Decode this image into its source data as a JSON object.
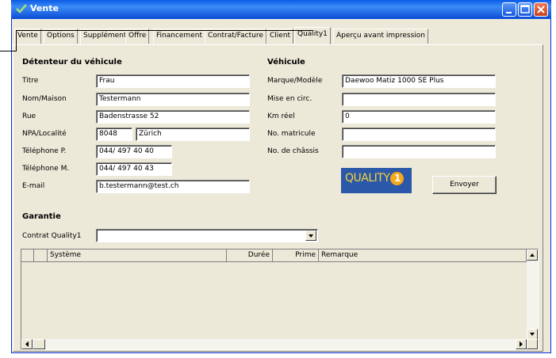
{
  "window": {
    "title": "Vente"
  },
  "tabs": [
    {
      "label": "Vente"
    },
    {
      "label": "Options"
    },
    {
      "label": "Supplément"
    },
    {
      "label": "Offre"
    },
    {
      "label": "Financement"
    },
    {
      "label": "Contrat/Facture"
    },
    {
      "label": "Client"
    },
    {
      "label": "Quality1"
    },
    {
      "label": "Aperçu avant impression"
    }
  ],
  "active_tab": "Quality1",
  "holder": {
    "heading": "Détenteur du véhicule",
    "fields": [
      {
        "label": "Titre",
        "value": "Frau"
      },
      {
        "label": "Nom/Maison",
        "value": "Testermann"
      },
      {
        "label": "Rue",
        "value": "Badenstrasse 52"
      },
      {
        "label": "NPA/Localité",
        "value": "8048",
        "value2": "Zürich"
      },
      {
        "label": "Téléphone P.",
        "value": "044/ 497 40 40"
      },
      {
        "label": "Téléphone M.",
        "value": "044/ 497 40 43"
      },
      {
        "label": "E-mail",
        "value": "b.testermann@test.ch"
      }
    ]
  },
  "vehicle": {
    "heading": "Véhicule",
    "fields": [
      {
        "label": "Marque/Modèle",
        "value": "Daewoo Matiz 1000 SE Plus"
      },
      {
        "label": "Mise en circ.",
        "value": ""
      },
      {
        "label": "Km réel",
        "value": "0"
      },
      {
        "label": "No. matricule",
        "value": ""
      },
      {
        "label": "No. de châssis",
        "value": ""
      }
    ]
  },
  "logo": {
    "text": "QUALITY",
    "number": "1"
  },
  "send_button": "Envoyer",
  "guarantee": {
    "heading": "Garantie",
    "contract_label": "Contrat Quality1",
    "contract_value": ""
  },
  "grid": {
    "columns": [
      "Système",
      "Durée",
      "Prime",
      "Remarque"
    ],
    "rows": []
  },
  "colors": {
    "titlebar": "#0a5ae6",
    "dialog_bg": "#ece9d8",
    "logo_bg": "#2b58a8",
    "logo_text": "#f6d33b",
    "logo_badge": "#f5a81c"
  }
}
